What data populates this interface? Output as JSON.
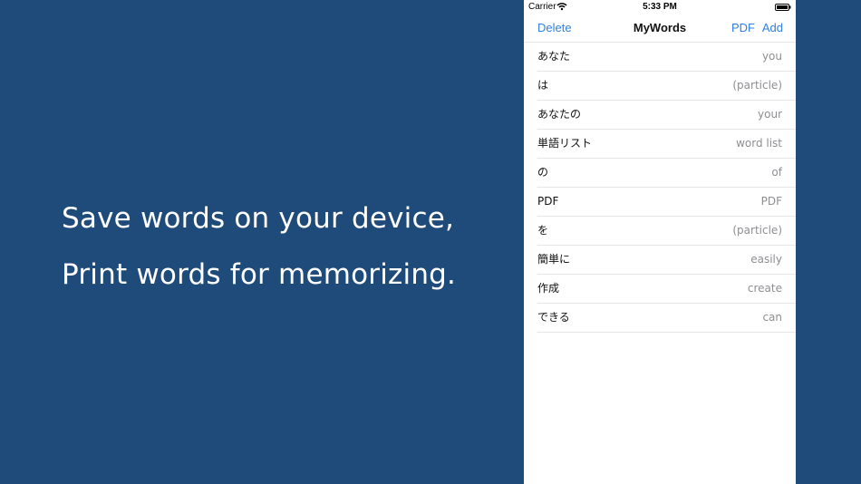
{
  "promo": {
    "line1": "Save words on your device,",
    "line2": "Print words for memorizing."
  },
  "status_bar": {
    "carrier": "Carrier",
    "time": "5:33 PM",
    "wifi_icon": "wifi-icon",
    "battery_icon": "battery-icon"
  },
  "nav": {
    "delete_label": "Delete",
    "title": "MyWords",
    "pdf_label": "PDF",
    "add_label": "Add"
  },
  "words": [
    {
      "term": "あなた",
      "meaning": "you"
    },
    {
      "term": "は",
      "meaning": "(particle)"
    },
    {
      "term": "あなたの",
      "meaning": "your"
    },
    {
      "term": "単語リスト",
      "meaning": "word list"
    },
    {
      "term": "の",
      "meaning": "of"
    },
    {
      "term": "PDF",
      "meaning": "PDF"
    },
    {
      "term": "を",
      "meaning": "(particle)"
    },
    {
      "term": "簡単に",
      "meaning": "easily"
    },
    {
      "term": "作成",
      "meaning": "create"
    },
    {
      "term": "できる",
      "meaning": "can"
    }
  ],
  "colors": {
    "background": "#1f4b7a",
    "accent": "#2f7fe3",
    "separator": "#e6e6ea",
    "secondary_text": "#8e8e93"
  }
}
